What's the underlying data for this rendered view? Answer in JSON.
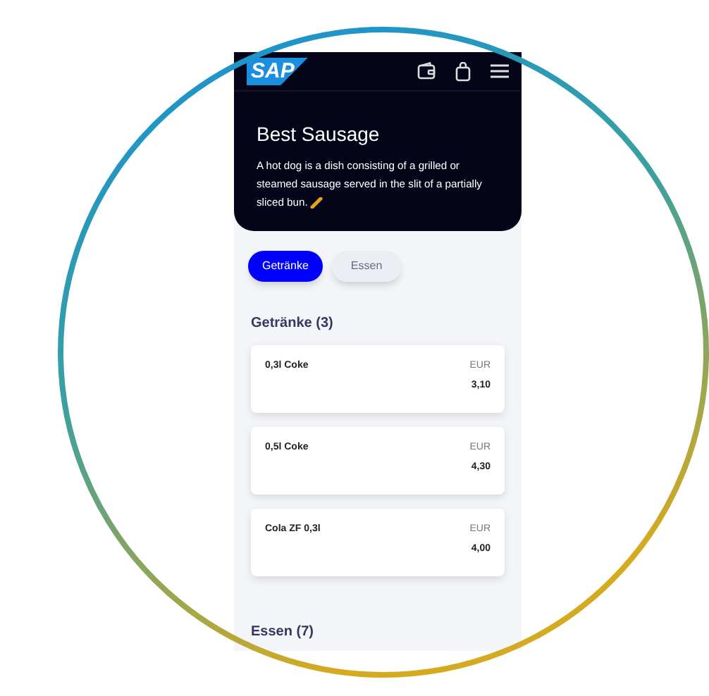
{
  "header": {
    "logo": "SAP"
  },
  "hero": {
    "title": "Best Sausage",
    "description": "A hot dog is a dish consisting of a grilled or steamed sausage served in the slit of a partially sliced bun."
  },
  "tabs": [
    {
      "label": "Getränke",
      "selected": true
    },
    {
      "label": "Essen",
      "selected": false
    }
  ],
  "sections": [
    {
      "title": "Getränke (3)",
      "items": [
        {
          "name": "0,3l Coke",
          "currency": "EUR",
          "price": "3,10"
        },
        {
          "name": "0,5l Coke",
          "currency": "EUR",
          "price": "4,30"
        },
        {
          "name": "Cola ZF 0,3l",
          "currency": "EUR",
          "price": "4,00"
        }
      ]
    },
    {
      "title": "Essen (7)"
    }
  ]
}
